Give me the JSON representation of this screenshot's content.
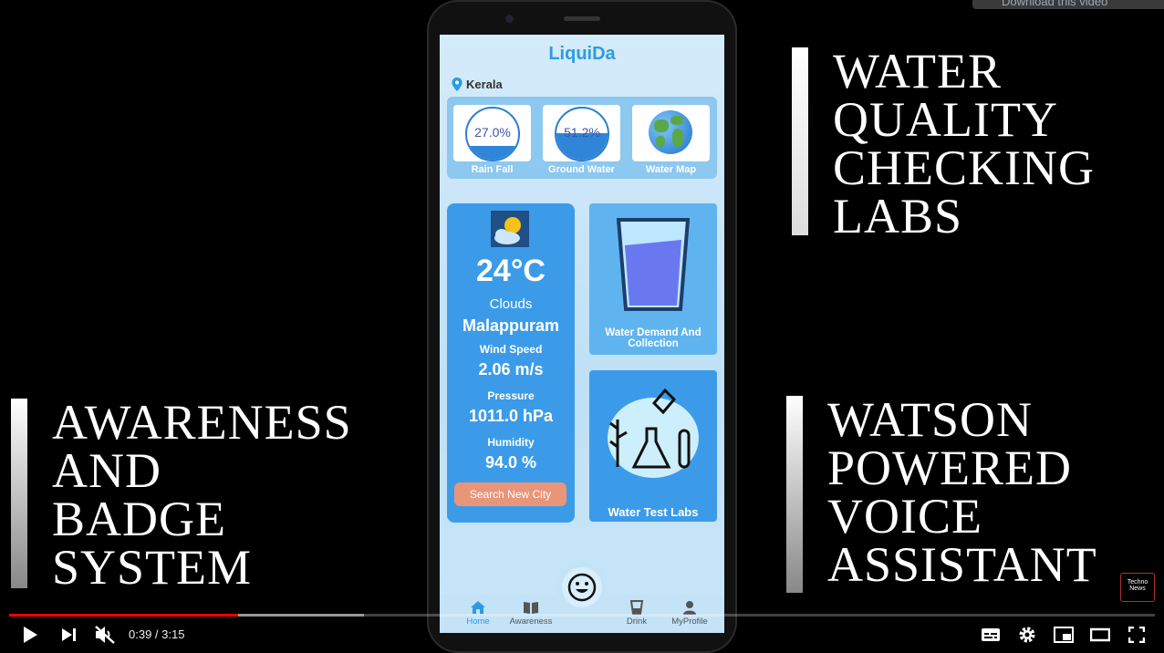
{
  "overlay_captions": {
    "top_right": [
      "WATER",
      "QUALITY",
      "CHECKING",
      "LABS"
    ],
    "bottom_left": [
      "AWARENESS",
      "AND",
      "BADGE",
      "SYSTEM"
    ],
    "bottom_right": [
      "WATSON",
      "POWERED",
      "VOICE",
      "ASSISTANT"
    ]
  },
  "download_button_label": "Download this video",
  "app": {
    "title": "LiquiDa",
    "location": "Kerala",
    "tiles": [
      {
        "label": "Rain Fall",
        "value": "27.0%",
        "fill": 0.27
      },
      {
        "label": "Ground Water",
        "value": "51.2%",
        "fill": 0.51
      },
      {
        "label": "Water Map",
        "icon": "globe-icon"
      }
    ],
    "weather": {
      "temperature": "24°C",
      "condition": "Clouds",
      "city": "Malappuram",
      "wind_label": "Wind Speed",
      "wind_value": "2.06 m/s",
      "pressure_label": "Pressure",
      "pressure_value": "1011.0 hPa",
      "humidity_label": "Humidity",
      "humidity_value": "94.0 %",
      "search_button": "Search New City"
    },
    "cards": {
      "demand": "Water Demand And Collection",
      "labs": "Water Test Labs"
    },
    "nav": [
      {
        "label": "Home",
        "icon": "home-icon",
        "active": true
      },
      {
        "label": "Awareness",
        "icon": "book-icon",
        "active": false
      },
      {
        "label": "Drink",
        "icon": "cup-icon",
        "active": false
      },
      {
        "label": "MyProfile",
        "icon": "person-icon",
        "active": false
      }
    ]
  },
  "player": {
    "time": "0:39 / 3:15",
    "played_fraction": 0.2,
    "loaded_fraction": 0.31
  },
  "watermark": {
    "line1": "Techno",
    "line2": "News"
  },
  "colors": {
    "accent": "#2d9be3",
    "progress": "#ff0000",
    "search_button": "#e9957a"
  }
}
